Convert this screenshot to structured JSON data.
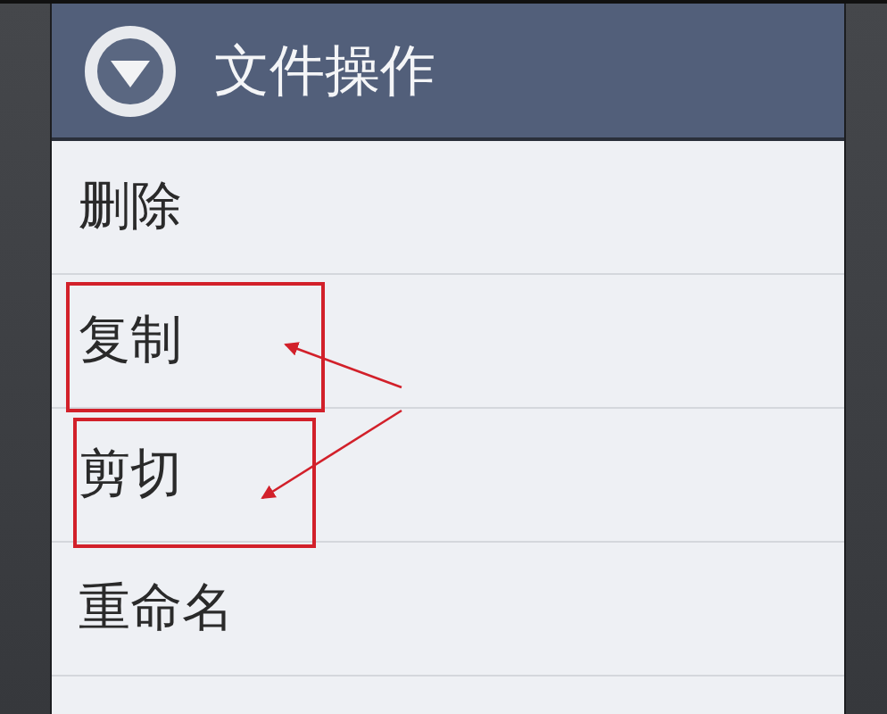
{
  "dialog": {
    "title": "文件操作"
  },
  "items": [
    {
      "label": "删除",
      "annotated": false
    },
    {
      "label": "复制",
      "annotated": true
    },
    {
      "label": "剪切",
      "annotated": true
    },
    {
      "label": "重命名",
      "annotated": false
    }
  ]
}
